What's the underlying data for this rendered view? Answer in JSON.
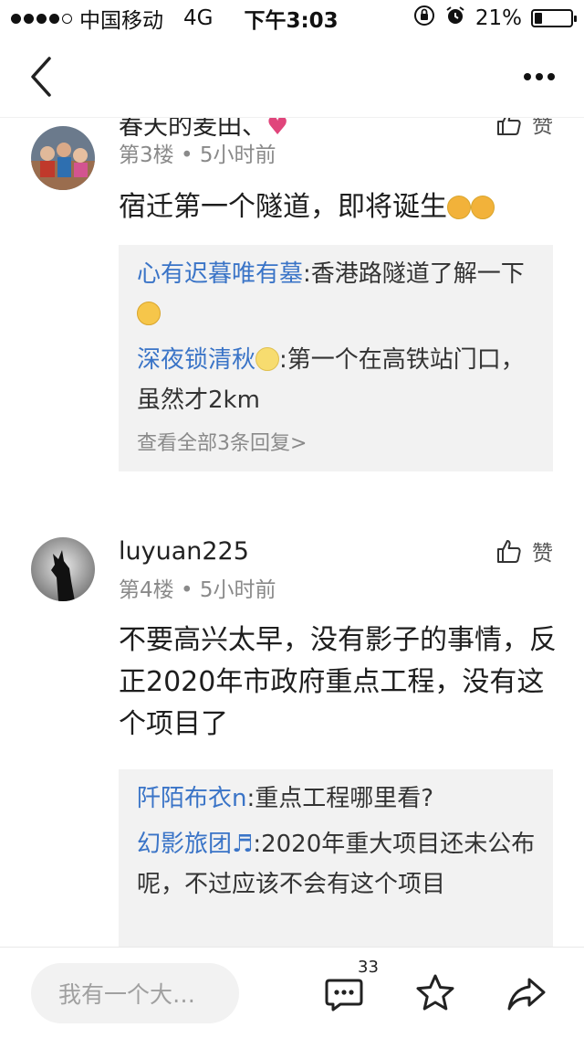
{
  "status_bar": {
    "carrier": "中国移动",
    "network": "4G",
    "time": "下午3:03",
    "battery_percent_label": "21%",
    "battery_level": 0.21
  },
  "posts": [
    {
      "username": "春天的麦田、",
      "floor": "第3楼",
      "time_ago": "5小时前",
      "like_label": "赞",
      "text": "宿迁第一个隧道，即将诞生",
      "replies": [
        {
          "name": "心有迟暮唯有墓",
          "text": ":香港路隧道了解一下"
        },
        {
          "name": "深夜锁清秋",
          "text": ":第一个在高铁站门口，虽然才2km"
        }
      ],
      "view_all": "查看全部3条回复>"
    },
    {
      "username": "luyuan225",
      "floor": "第4楼",
      "time_ago": "5小时前",
      "like_label": "赞",
      "text": "不要高兴太早，没有影子的事情，反正2020年市政府重点工程，没有这个项目了",
      "replies": [
        {
          "name": "阡陌布衣n",
          "text": ":重点工程哪里看?"
        },
        {
          "name": "幻影旅团",
          "text": ":2020年重大项目还未公布呢，不过应该不会有这个项目"
        }
      ]
    }
  ],
  "bottom_bar": {
    "input_placeholder": "我有一个大…",
    "comment_count": "33"
  },
  "icons": {
    "back": "chevron-left-icon",
    "more": "more-dots-icon",
    "like": "thumbs-up-icon",
    "comment": "comment-bubble-icon",
    "favorite": "star-icon",
    "share": "share-arrow-icon"
  }
}
